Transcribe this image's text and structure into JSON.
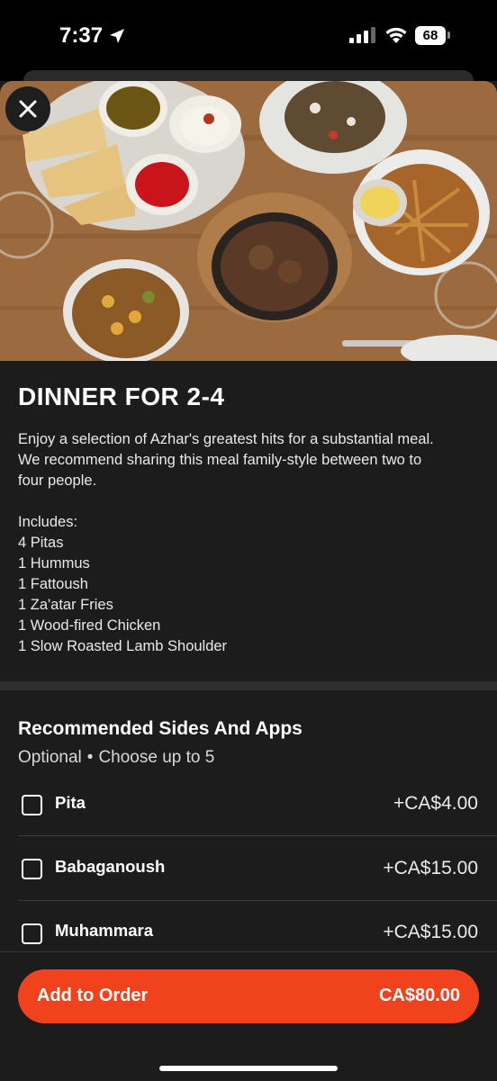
{
  "status_bar": {
    "time": "7:37",
    "battery": "68"
  },
  "item": {
    "title": "DINNER FOR 2-4",
    "description_lines": [
      "Enjoy a selection of Azhar's greatest hits for a substantial meal.",
      "We recommend sharing this meal family-style between two to",
      "four people."
    ],
    "includes_heading": "Includes:",
    "includes": [
      "4 Pitas",
      "1 Hummus",
      "1 Fattoush",
      "1 Za'atar Fries",
      "1 Wood-fired Chicken",
      "1 Slow Roasted Lamb Shoulder"
    ]
  },
  "sides": {
    "title": "Recommended Sides And Apps",
    "optional": "Optional",
    "separator": "•",
    "choose": "Choose up to 5",
    "options": [
      {
        "label": "Pita",
        "price": "+CA$4.00",
        "checked": false
      },
      {
        "label": "Babaganoush",
        "price": "+CA$15.00",
        "checked": false
      },
      {
        "label": "Muhammara",
        "price": "+CA$15.00",
        "checked": false
      }
    ]
  },
  "cta": {
    "label": "Add to Order",
    "price": "CA$80.00"
  },
  "colors": {
    "accent": "#f0421c",
    "background": "#1c1c1c"
  }
}
